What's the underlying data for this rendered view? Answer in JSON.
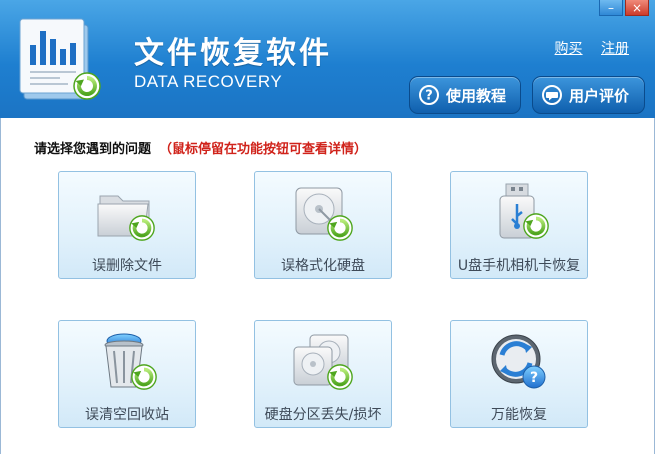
{
  "header": {
    "title": "文件恢复软件",
    "subtitle": "DATA RECOVERY",
    "links": {
      "buy": "购买",
      "register": "注册"
    },
    "window_buttons": {
      "minimize": "–",
      "close": "×"
    },
    "buttons": {
      "tutorial": "使用教程",
      "review": "用户评价"
    }
  },
  "main": {
    "question": "请选择您遇到的问题",
    "hint": "（鼠标停留在功能按钮可查看详情）",
    "cards": [
      {
        "label": "误删除文件",
        "icon": "folder-recover-icon"
      },
      {
        "label": "误格式化硬盘",
        "icon": "harddisk-recover-icon"
      },
      {
        "label": "U盘手机相机卡恢复",
        "icon": "usb-drive-recover-icon"
      },
      {
        "label": "误清空回收站",
        "icon": "recycle-bin-recover-icon"
      },
      {
        "label": "硬盘分区丢失/损坏",
        "icon": "partition-recover-icon"
      },
      {
        "label": "万能恢复",
        "icon": "universal-recover-icon"
      }
    ]
  },
  "colors": {
    "header_top": "#4aa6e6",
    "header_bottom": "#1b74c4",
    "hint": "#d0231b",
    "card_border": "#93c1e2"
  }
}
